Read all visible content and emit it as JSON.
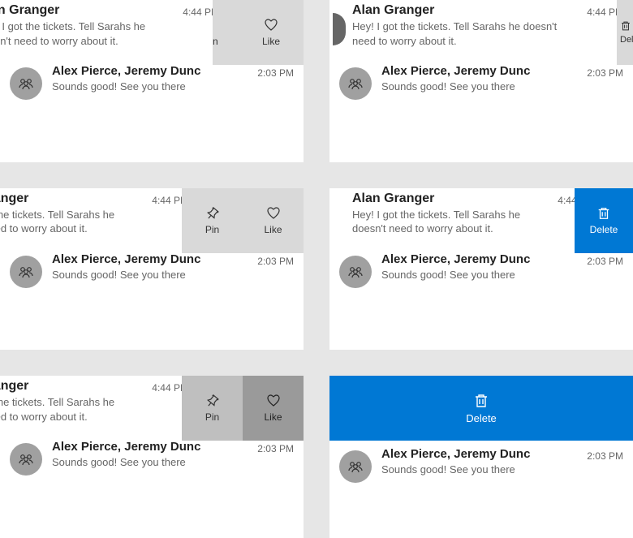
{
  "sender": {
    "name": "Alan Granger",
    "preview": "Hey! I got the tickets. Tell Sarahs he doesn't need to worry about it.",
    "time": "4:44 PM"
  },
  "group": {
    "name": "Alex Pierce, Jeremy Dunc",
    "preview": "Sounds good! See you there",
    "time": "2:03 PM"
  },
  "actions": {
    "pin": "Pin",
    "like": "Like",
    "delete": "Delete"
  },
  "truncated": {
    "granger_short": "anger",
    "granger_mid": "er",
    "granger_n": "n Granger",
    "preview_short": "he tickets. Tell Sarahs he doesn't rry about it.",
    "preview_mid": "ets. Tell Sarahs he doesn't out it.",
    "preview_n": "got the tickets. Tell Sarahs he doesn't to worry about it.",
    "pin_n": "n"
  }
}
